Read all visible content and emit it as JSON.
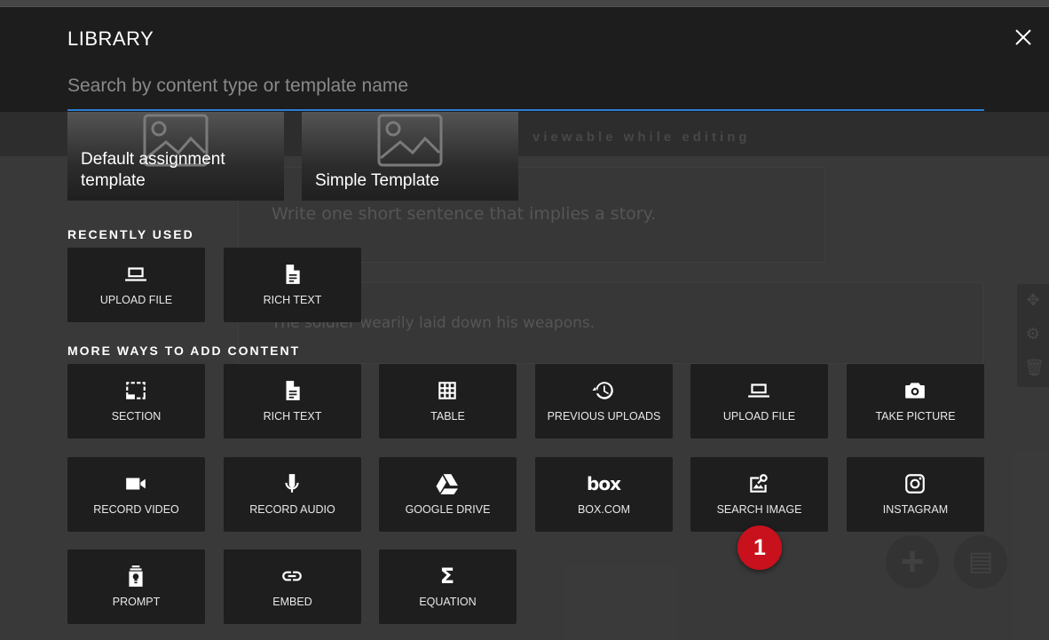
{
  "background_page": {
    "banner_text": "viewable while editing",
    "prompt_text": "Write one short sentence that implies a story.",
    "response_text": "The soldier wearily laid down his weapons."
  },
  "library": {
    "title": "LIBRARY",
    "search": {
      "placeholder": "Search by content type or template name",
      "value": ""
    },
    "templates": [
      {
        "label": "Default assignment template",
        "icon": "image-placeholder-icon"
      },
      {
        "label": "Simple Template",
        "icon": "image-placeholder-icon"
      }
    ],
    "recently_used": {
      "heading": "RECENTLY USED",
      "items": [
        {
          "label": "UPLOAD FILE",
          "icon": "laptop-icon"
        },
        {
          "label": "RICH TEXT",
          "icon": "document-icon"
        }
      ]
    },
    "more_ways": {
      "heading": "MORE WAYS TO ADD CONTENT",
      "items": [
        {
          "label": "SECTION",
          "icon": "section-icon"
        },
        {
          "label": "RICH TEXT",
          "icon": "document-icon"
        },
        {
          "label": "TABLE",
          "icon": "table-icon"
        },
        {
          "label": "PREVIOUS UPLOADS",
          "icon": "history-icon"
        },
        {
          "label": "UPLOAD FILE",
          "icon": "laptop-icon"
        },
        {
          "label": "TAKE PICTURE",
          "icon": "camera-icon"
        },
        {
          "label": "RECORD VIDEO",
          "icon": "video-camera-icon"
        },
        {
          "label": "RECORD AUDIO",
          "icon": "microphone-icon"
        },
        {
          "label": "GOOGLE DRIVE",
          "icon": "google-drive-icon"
        },
        {
          "label": "BOX.COM",
          "icon": "box-logo-icon",
          "glyph": "box"
        },
        {
          "label": "SEARCH IMAGE",
          "icon": "image-search-icon"
        },
        {
          "label": "INSTAGRAM",
          "icon": "instagram-icon"
        },
        {
          "label": "PROMPT",
          "icon": "prompt-icon"
        },
        {
          "label": "EMBED",
          "icon": "link-icon"
        },
        {
          "label": "EQUATION",
          "icon": "sigma-icon",
          "glyph": "Σ"
        }
      ]
    }
  },
  "annotation_badge": {
    "label": "1",
    "color": "#c8111c"
  },
  "colors": {
    "accent": "#2a7fd4",
    "tile_bg": "#1e1e1e"
  }
}
